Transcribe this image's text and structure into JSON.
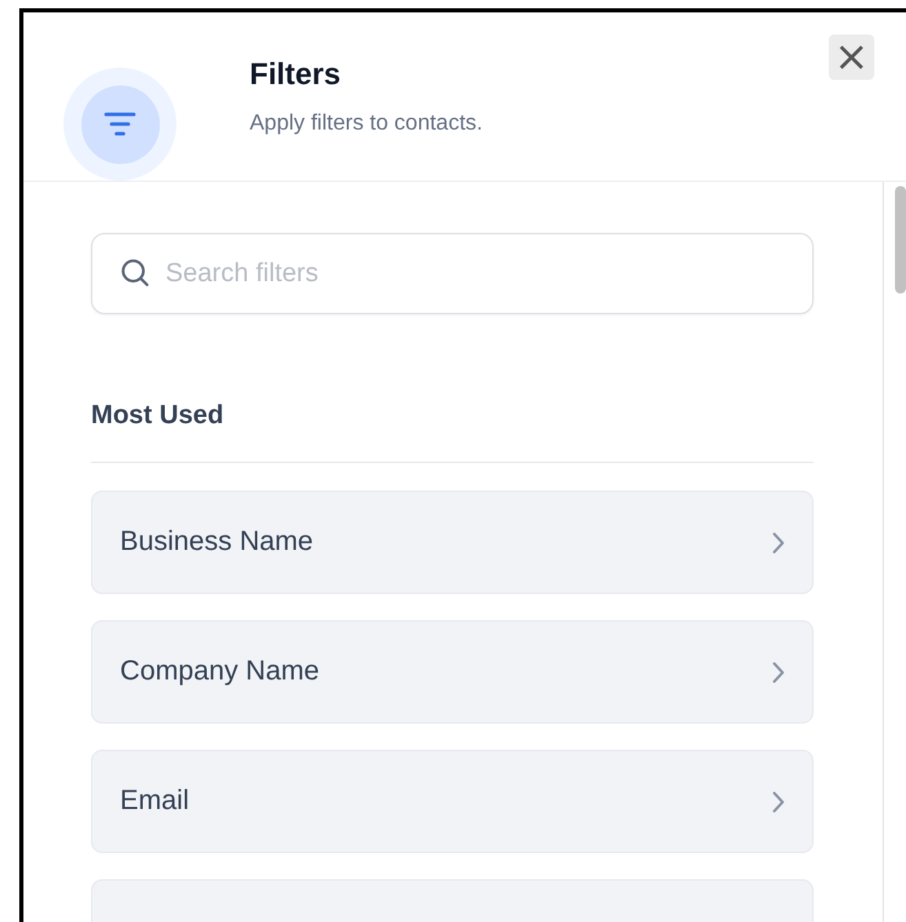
{
  "header": {
    "title": "Filters",
    "subtitle": "Apply filters to contacts.",
    "close_label": "×"
  },
  "search": {
    "placeholder": "Search filters"
  },
  "section": {
    "title": "Most Used"
  },
  "filters": [
    {
      "label": "Business Name"
    },
    {
      "label": "Company Name"
    },
    {
      "label": "Email"
    }
  ]
}
